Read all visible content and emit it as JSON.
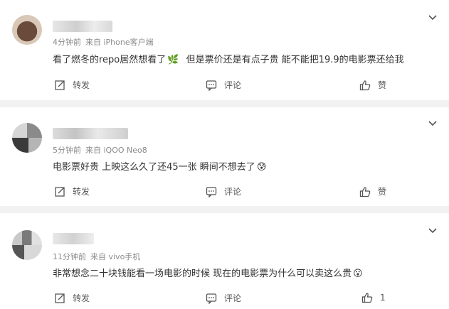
{
  "comments": [
    {
      "meta": {
        "time": "4分钟前",
        "source": "来自 iPhone客户端"
      },
      "text": "看了燃冬的repo居然想看了",
      "emoji": "🌿",
      "text2": "但是票价还是有点子贵 能不能把19.9的电影票还给我",
      "actions": {
        "repost": "转发",
        "comment": "评论",
        "like": "赞"
      }
    },
    {
      "meta": {
        "time": "5分钟前",
        "source": "来自 iQOO Neo8"
      },
      "text": "电影票好贵 上映这么久了还45一张 瞬间不想去了",
      "emoji": "😰",
      "actions": {
        "repost": "转发",
        "comment": "评论",
        "like": "赞"
      }
    },
    {
      "meta": {
        "time": "11分钟前",
        "source": "来自 vivo手机"
      },
      "text": "非常想念二十块钱能看一场电影的时候 现在的电影票为什么可以卖这么贵",
      "emoji": "😮",
      "actions": {
        "repost": "转发",
        "comment": "评论",
        "like": "1"
      }
    }
  ],
  "icons": {
    "more": "chevron-down-icon",
    "repost": "repost-icon",
    "comment": "comment-icon",
    "like": "thumb-up-icon"
  },
  "colors": {
    "meta": "#8a8a8a",
    "text": "#333333",
    "separator": "#f2f2f2"
  }
}
